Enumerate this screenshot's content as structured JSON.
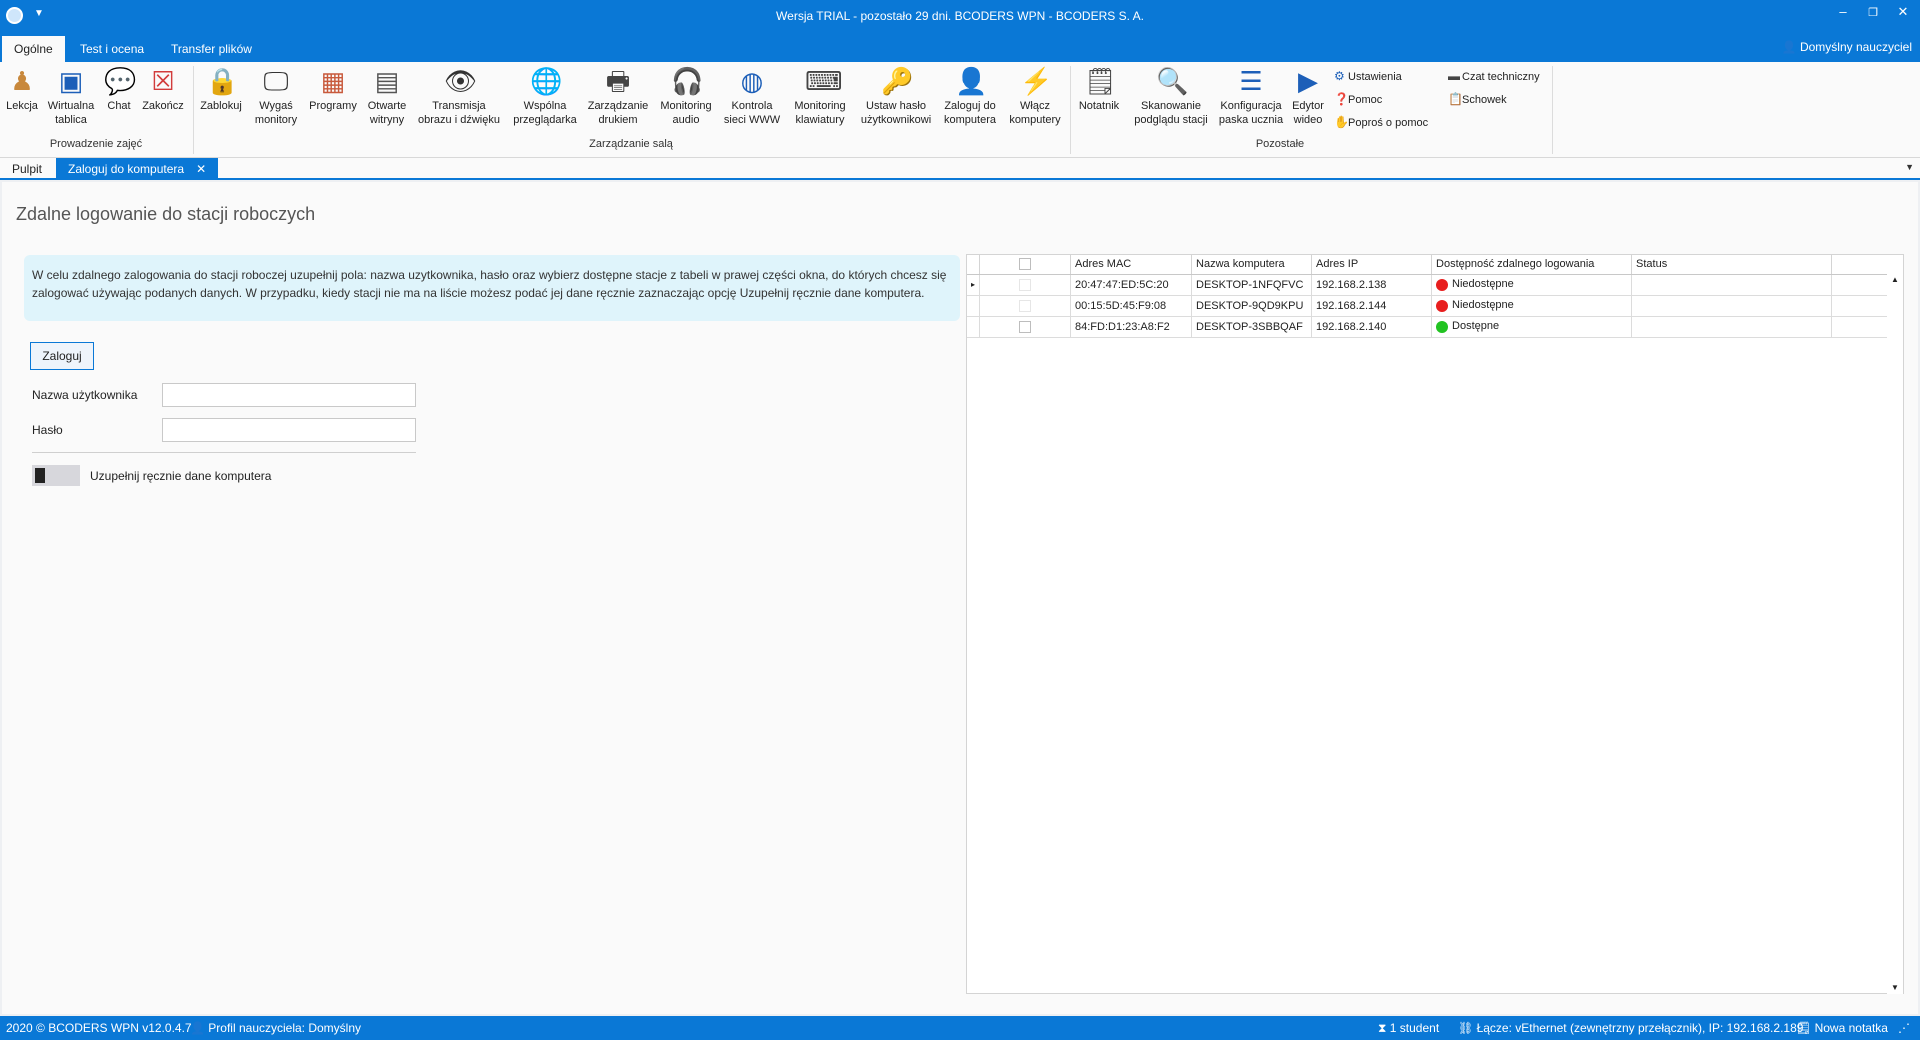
{
  "app": {
    "title": "Wersja TRIAL - pozostało 29 dni. BCODERS WPN - BCODERS S. A."
  },
  "menu": {
    "tabs": [
      "Ogólne",
      "Test i ocena",
      "Transfer plików"
    ],
    "user": "Domyślny nauczyciel"
  },
  "ribbon": {
    "group1": {
      "label": "Prowadzenie zajęć",
      "buttons": [
        "Lekcja",
        "Wirtualna\ntablica",
        "Chat",
        "Zakończ"
      ]
    },
    "group2": {
      "label": "Zarządzanie salą",
      "buttons": [
        "Zablokuj",
        "Wygaś\nmonitory",
        "Programy",
        "Otwarte\nwitryny",
        "Transmisja\nobrazu i dźwięku",
        "Wspólna\nprzeglądarka",
        "Zarządzanie\ndrukiem",
        "Monitoring\naudio",
        "Kontrola\nsieci WWW",
        "Monitoring\nklawiatury",
        "Ustaw hasło\nużytkownikowi",
        "Zaloguj do\nkomputera",
        "Włącz\nkomputery"
      ]
    },
    "group3": {
      "label": "Pozostałe",
      "buttons": [
        "Notatnik",
        "Skanowanie\npodglądu stacji",
        "Konfiguracja\npaska ucznia",
        "Edytor\nwideo"
      ],
      "small_left": [
        "Ustawienia",
        "Pomoc",
        "Poproś o pomoc"
      ],
      "small_right": [
        "Czat techniczny",
        "Schowek"
      ]
    }
  },
  "doctabs": [
    "Pulpit",
    "Zaloguj do komputera"
  ],
  "page": {
    "title": "Zdalne logowanie do stacji roboczych",
    "info": "W celu zdalnego zalogowania do stacji roboczej uzupełnij pola: nazwa uzytkownika, hasło oraz wybierz dostępne stacje z tabeli w prawej części okna, do których chcesz się zalogować używając podanych danych. W przypadku, kiedy stacji nie ma na liście możesz podać jej dane ręcznie zaznaczając opcję Uzupełnij ręcznie dane komputera.",
    "login_button": "Zaloguj",
    "username_label": "Nazwa użytkownika",
    "username_value": "",
    "password_label": "Hasło",
    "password_value": "",
    "manual_toggle_label": "Uzupełnij ręcznie dane komputera",
    "manual_toggle_on": false
  },
  "table": {
    "columns": [
      "Adres MAC",
      "Nazwa komputera",
      "Adres IP",
      "Dostępność zdalnego logowania",
      "Status"
    ],
    "rows": [
      {
        "mac": "20:47:47:ED:5C:20",
        "name": "DESKTOP-1NFQFVC",
        "ip": "192.168.2.138",
        "avail": "Niedostępne",
        "avail_color": "#e81e1e",
        "status": ""
      },
      {
        "mac": "00:15:5D:45:F9:08",
        "name": "DESKTOP-9QD9KPU",
        "ip": "192.168.2.144",
        "avail": "Niedostępne",
        "avail_color": "#e81e1e",
        "status": ""
      },
      {
        "mac": "84:FD:D1:23:A8:F2",
        "name": "DESKTOP-3SBBQAF",
        "ip": "192.168.2.140",
        "avail": "Dostępne",
        "avail_color": "#22c322",
        "status": ""
      }
    ]
  },
  "status": {
    "copyright": "2020 ©  BCODERS WPN v12.0.4.7",
    "profile": "Profil nauczyciela: Domyślny",
    "students": "1 student",
    "connection": "Łącze: vEthernet (zewnętrzny przełącznik), IP: 192.168.2.189",
    "note": "Nowa notatka"
  },
  "colors": {
    "accent": "#0a78d6",
    "info_bg": "#dff4fb",
    "available": "#22c322",
    "unavailable": "#e81e1e"
  }
}
